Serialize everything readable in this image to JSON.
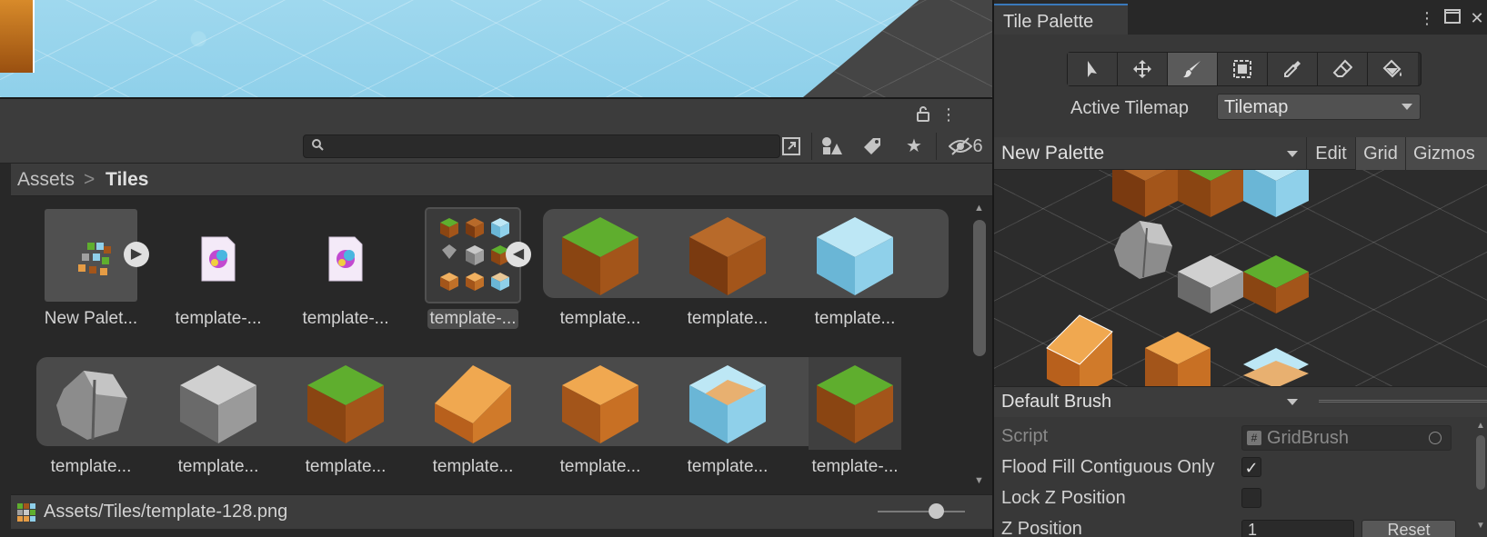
{
  "project": {
    "search": {
      "value": "",
      "placeholder": ""
    },
    "hidden_count": "6",
    "breadcrumb": {
      "root": "Assets",
      "separator": ">",
      "current": "Tiles"
    },
    "assets_row1": [
      {
        "label": "New Palet..."
      },
      {
        "label": "template-..."
      },
      {
        "label": "template-..."
      },
      {
        "label": "template-..."
      },
      {
        "label": "template..."
      },
      {
        "label": "template..."
      },
      {
        "label": "template..."
      }
    ],
    "assets_row2": [
      {
        "label": "template..."
      },
      {
        "label": "template..."
      },
      {
        "label": "template..."
      },
      {
        "label": "template..."
      },
      {
        "label": "template..."
      },
      {
        "label": "template..."
      },
      {
        "label": "template-..."
      }
    ],
    "status_path": "Assets/Tiles/template-128.png",
    "zoom_level": 0.6
  },
  "tile_palette": {
    "title": "Tile Palette",
    "tools": [
      "select-tool",
      "move-tool",
      "paint-brush-tool",
      "box-fill-tool",
      "picker-tool",
      "eraser-tool",
      "flood-fill-tool"
    ],
    "active_tool": "paint-brush-tool",
    "active_tilemap_label": "Active Tilemap",
    "active_tilemap_value": "Tilemap",
    "palette_name": "New Palette",
    "edit_label": "Edit",
    "grid_label": "Grid",
    "gizmos_label": "Gizmos",
    "brush_name": "Default Brush",
    "inspector": {
      "script_label": "Script",
      "script_value": "GridBrush",
      "flood_fill_label": "Flood Fill Contiguous Only",
      "flood_fill_checked": true,
      "lock_z_label": "Lock Z Position",
      "lock_z_checked": false,
      "z_position_label": "Z Position",
      "z_position_value": "1",
      "reset_label": "Reset"
    }
  },
  "colors": {
    "grass": "#5fae2e",
    "dirt": "#a3551a",
    "ice": "#8fd0ea",
    "sand": "#e59c45",
    "stone": "#a0a0a0",
    "accent": "#3a79bb"
  }
}
